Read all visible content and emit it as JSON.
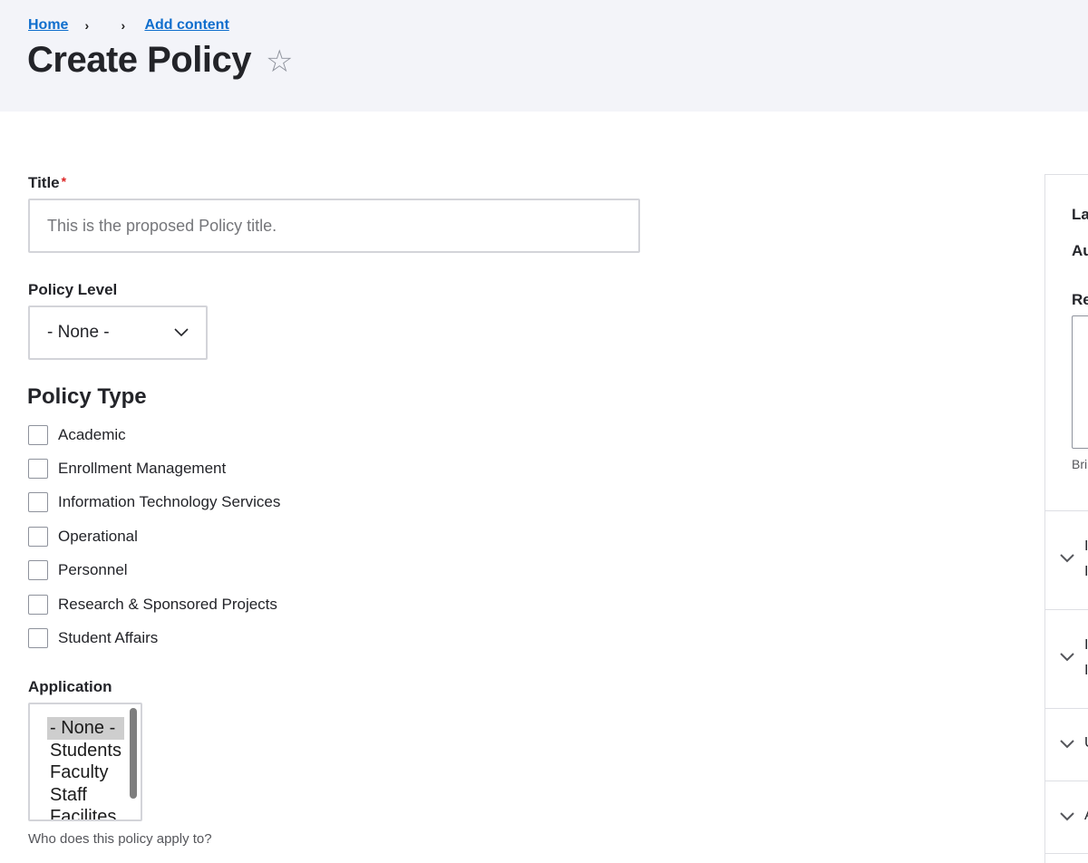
{
  "header": {
    "breadcrumb": [
      {
        "label": "Home"
      },
      {
        "label": ""
      },
      {
        "label": "Add content"
      }
    ],
    "breadcrumb_separator": "›",
    "title": "Create Policy",
    "favorite_icon": "☆"
  },
  "form": {
    "title_field": {
      "label": "Title",
      "required_marker": "*",
      "value": "",
      "placeholder": "This is the proposed Policy title."
    },
    "policy_level": {
      "label": "Policy Level",
      "selected": "- None -"
    },
    "policy_type": {
      "heading": "Policy Type",
      "options": [
        {
          "label": "Academic",
          "checked": false
        },
        {
          "label": "Enrollment Management",
          "checked": false
        },
        {
          "label": "Information Technology Services",
          "checked": false
        },
        {
          "label": "Operational",
          "checked": false
        },
        {
          "label": "Personnel",
          "checked": false
        },
        {
          "label": "Research & Sponsored Projects",
          "checked": false
        },
        {
          "label": "Student Affairs",
          "checked": false
        }
      ]
    },
    "application": {
      "label": "Application",
      "options": [
        "- None -",
        "Students",
        "Faculty",
        "Staff",
        "Facilites"
      ],
      "selected": "- None -",
      "help": "Who does this policy apply to?"
    }
  },
  "sidebar": {
    "labels_partial": [
      "La",
      "Au",
      "Re"
    ],
    "help_partial": "Bri",
    "accordions_partial": [
      {
        "line1": "I",
        "line2": "I"
      },
      {
        "line1": "I",
        "line2": "I"
      },
      {
        "line1": "U",
        "line2": ""
      },
      {
        "line1": "A",
        "line2": ""
      }
    ]
  },
  "colors": {
    "link": "#0f6ecd",
    "required": "#dc2323",
    "header_bg": "#f3f4f9"
  }
}
